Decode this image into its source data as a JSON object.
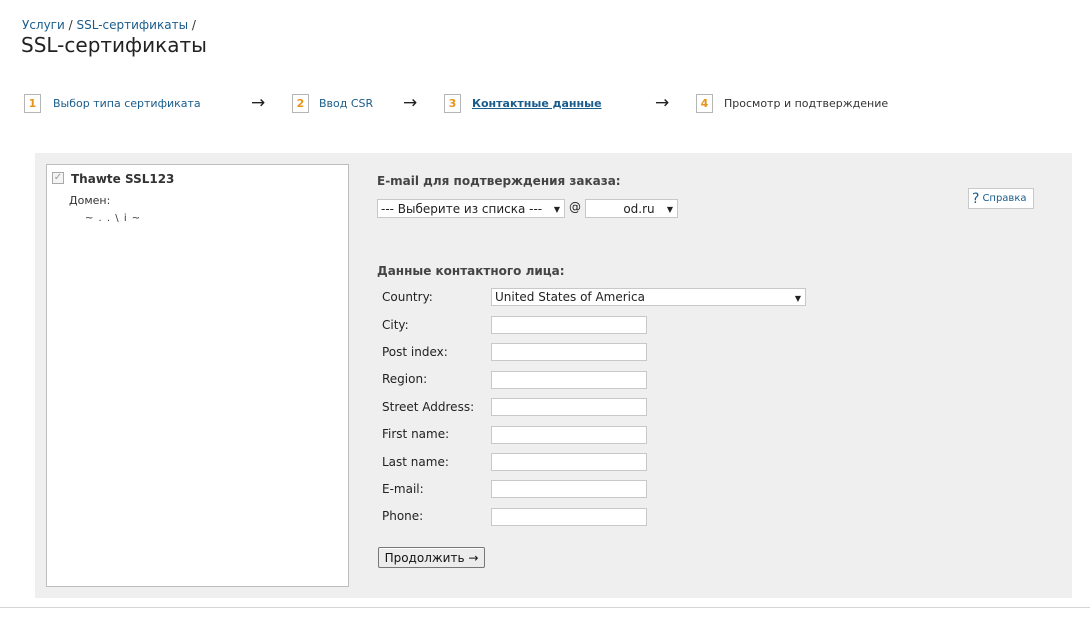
{
  "breadcrumb": {
    "items": [
      "Услуги",
      "SSL-сертификаты"
    ],
    "separator": "/"
  },
  "page_title": "SSL-сертификаты",
  "steps": [
    {
      "number": "1",
      "label": "Выбор типа сертификата",
      "state": "link"
    },
    {
      "number": "2",
      "label": "Ввод CSR",
      "state": "link"
    },
    {
      "number": "3",
      "label": "Контактные данные",
      "state": "active"
    },
    {
      "number": "4",
      "label": "Просмотр и подтверждение",
      "state": "plain"
    }
  ],
  "step_arrow": "→",
  "certificate": {
    "name": "Thawte SSL123",
    "checked": true,
    "domain_label": "Домен:",
    "domain_value": "~ . . \\ i ~"
  },
  "email_section": {
    "title": "E-mail для подтверждения заказа:",
    "mailbox_select": "--- Выберите из списка ---",
    "at": "@",
    "domain_select": "         od.ru"
  },
  "help_button": {
    "icon": "question-icon",
    "label": "Справка"
  },
  "contact_section": {
    "title": "Данные контактного лица:",
    "country_label": "Country:",
    "country_value": "United States of America",
    "fields": [
      {
        "label": "City:",
        "value": ""
      },
      {
        "label": "Post index:",
        "value": ""
      },
      {
        "label": "Region:",
        "value": ""
      },
      {
        "label": "Street Address:",
        "value": ""
      },
      {
        "label": "First name:",
        "value": ""
      },
      {
        "label": "Last name:",
        "value": ""
      },
      {
        "label": "E-mail:",
        "value": ""
      },
      {
        "label": "Phone:",
        "value": ""
      }
    ]
  },
  "continue_button": "Продолжить →",
  "colors": {
    "link": "#1a5c8c",
    "step_number": "#e8931a",
    "panel_bg": "#efefef"
  }
}
